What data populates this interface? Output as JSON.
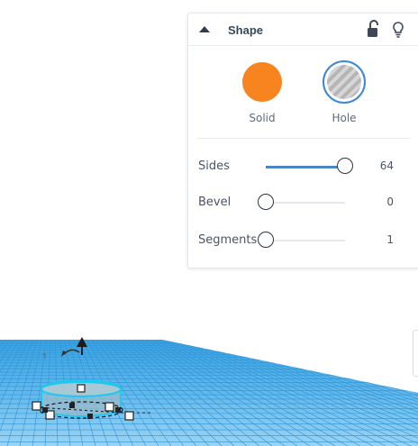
{
  "panel": {
    "title": "Shape",
    "collapse_icon": "triangle-up-icon",
    "lock_icon": "unlock-icon",
    "bulb_icon": "lightbulb-icon"
  },
  "shape_types": {
    "solid": {
      "label": "Solid",
      "color": "#f7841f"
    },
    "hole": {
      "label": "Hole",
      "selected": true,
      "border_color": "#3e88d6"
    }
  },
  "properties": {
    "sides": {
      "label": "Sides",
      "value": "64",
      "fraction": 1.0
    },
    "bevel": {
      "label": "Bevel",
      "value": "0",
      "fraction": 0.0
    },
    "segments": {
      "label": "Segments",
      "value": "1",
      "fraction": 0.0
    }
  },
  "colors": {
    "workplane": "#56b3e8",
    "grid_line": "#2f93d4",
    "slider_fill": "#4a86c8",
    "selection_outline": "#1ec8f0"
  }
}
